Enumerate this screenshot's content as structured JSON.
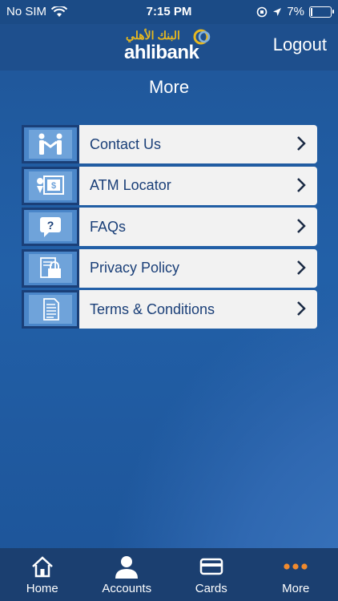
{
  "status": {
    "carrier": "No SIM",
    "time": "7:15 PM",
    "battery": "7%"
  },
  "header": {
    "logo_arabic": "البنك الأهلي",
    "logo_text": "ahlibank",
    "logout": "Logout"
  },
  "page": {
    "title": "More"
  },
  "menu": [
    {
      "label": "Contact Us",
      "icon": "handshake-icon"
    },
    {
      "label": "ATM Locator",
      "icon": "atm-location-icon"
    },
    {
      "label": "FAQs",
      "icon": "question-bubble-icon"
    },
    {
      "label": "Privacy Policy",
      "icon": "lock-document-icon"
    },
    {
      "label": "Terms & Conditions",
      "icon": "document-icon"
    }
  ],
  "tabs": [
    {
      "label": "Home",
      "icon": "home-icon"
    },
    {
      "label": "Accounts",
      "icon": "user-icon"
    },
    {
      "label": "Cards",
      "icon": "card-icon"
    },
    {
      "label": "More",
      "icon": "more-dots-icon",
      "active": true
    }
  ],
  "colors": {
    "accent": "#f08a2e",
    "header": "#1e4f8d",
    "logo_gold": "#e6b820",
    "tabbar": "#1b3f70"
  }
}
